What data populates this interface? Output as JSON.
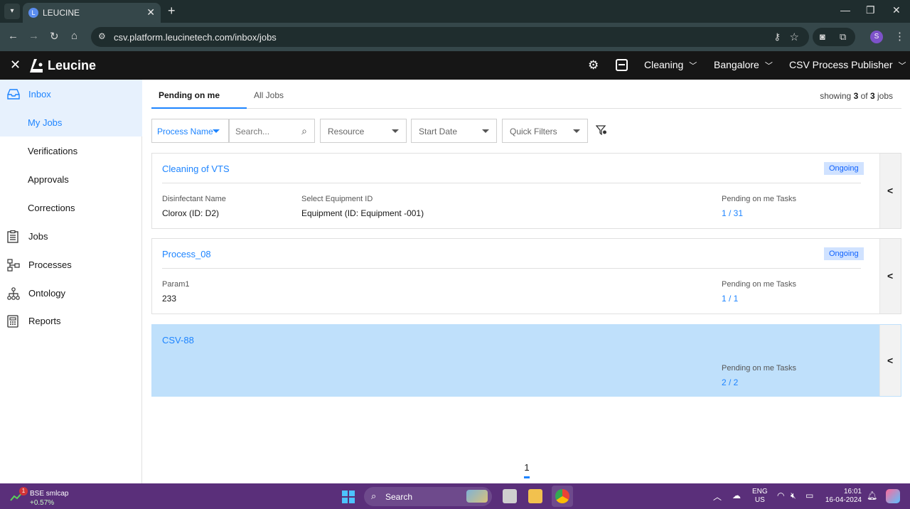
{
  "browser": {
    "tab_title": "LEUCINE",
    "url": "csv.platform.leucinetech.com/inbox/jobs",
    "profile_initial": "S"
  },
  "app": {
    "logo_text": "Leucine",
    "dropdowns": {
      "usecase": "Cleaning",
      "facility": "Bangalore",
      "role": "CSV Process Publisher"
    }
  },
  "sidebar": {
    "items": [
      {
        "label": "Inbox"
      },
      {
        "label": "My Jobs"
      },
      {
        "label": "Verifications"
      },
      {
        "label": "Approvals"
      },
      {
        "label": "Corrections"
      },
      {
        "label": "Jobs"
      },
      {
        "label": "Processes"
      },
      {
        "label": "Ontology"
      },
      {
        "label": "Reports"
      }
    ]
  },
  "main": {
    "tabs": [
      "Pending on me",
      "All Jobs"
    ],
    "showing": {
      "prefix": "showing",
      "count": "3",
      "of": "of",
      "total": "3",
      "suffix": "jobs"
    },
    "filters": {
      "process_name": "Process Name",
      "search_placeholder": "Search...",
      "resource": "Resource",
      "start_date": "Start Date",
      "quick_filters": "Quick Filters"
    },
    "jobs": [
      {
        "name": "Cleaning of VTS",
        "status": "Ongoing",
        "params": [
          {
            "label": "Disinfectant Name",
            "value": "Clorox (ID: D2)"
          },
          {
            "label": "Select Equipment ID",
            "value": "Equipment (ID: Equipment -001)"
          }
        ],
        "pending_label": "Pending on me Tasks",
        "pending_value": "1 / 31"
      },
      {
        "name": "Process_08",
        "status": "Ongoing",
        "params": [
          {
            "label": "Param1",
            "value": "233"
          }
        ],
        "pending_label": "Pending on me Tasks",
        "pending_value": "1 / 1"
      },
      {
        "name": "CSV-88",
        "pending_label": "Pending on me Tasks",
        "pending_value": "2 / 2"
      }
    ],
    "page": "1"
  },
  "taskbar": {
    "stock_name": "BSE smlcap",
    "stock_change": "+0.57%",
    "notif_count": "1",
    "search_label": "Search",
    "lang_line1": "ENG",
    "lang_line2": "US",
    "time": "16:01",
    "date": "16-04-2024"
  },
  "colors": {
    "accent": "#1d84ff",
    "header_bg": "#161616",
    "selected_card": "#bfe0fb",
    "badge_bg": "#d0e2ff"
  }
}
